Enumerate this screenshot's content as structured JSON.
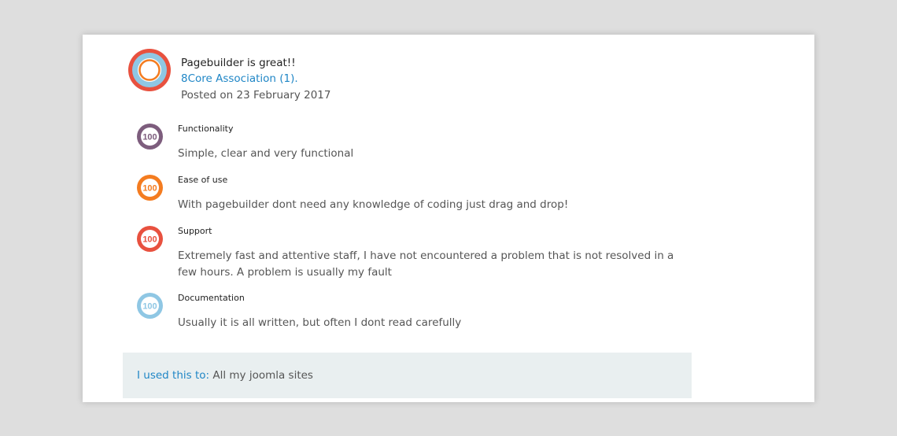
{
  "review": {
    "title": "Pagebuilder is great!!",
    "author": "8Core Association (1).",
    "posted": "Posted on 23 February 2017",
    "avatar_colors": [
      "#e8513f",
      "#8fc7e4",
      "#ffffff",
      "#f47c20"
    ]
  },
  "ratings": [
    {
      "label": "Functionality",
      "score": "100",
      "color": "#7d5d7d",
      "text": "Simple, clear and very functional"
    },
    {
      "label": "Ease of use",
      "score": "100",
      "color": "#f47c20",
      "text": "With pagebuilder dont need any knowledge of coding just drag and drop!"
    },
    {
      "label": "Support",
      "score": "100",
      "color": "#e8513f",
      "text": "Extremely fast and attentive staff, I have not encountered a problem that is not resolved in a few hours. A problem is usually my fault"
    },
    {
      "label": "Documentation",
      "score": "100",
      "color": "#8fc7e4",
      "text": "Usually it is all written, but often I dont read carefully"
    }
  ],
  "usage": {
    "key": "I used this to:",
    "value": "All my joomla sites"
  },
  "colors": {
    "link": "#1f86c6",
    "footer_bg": "#e9eff0"
  }
}
